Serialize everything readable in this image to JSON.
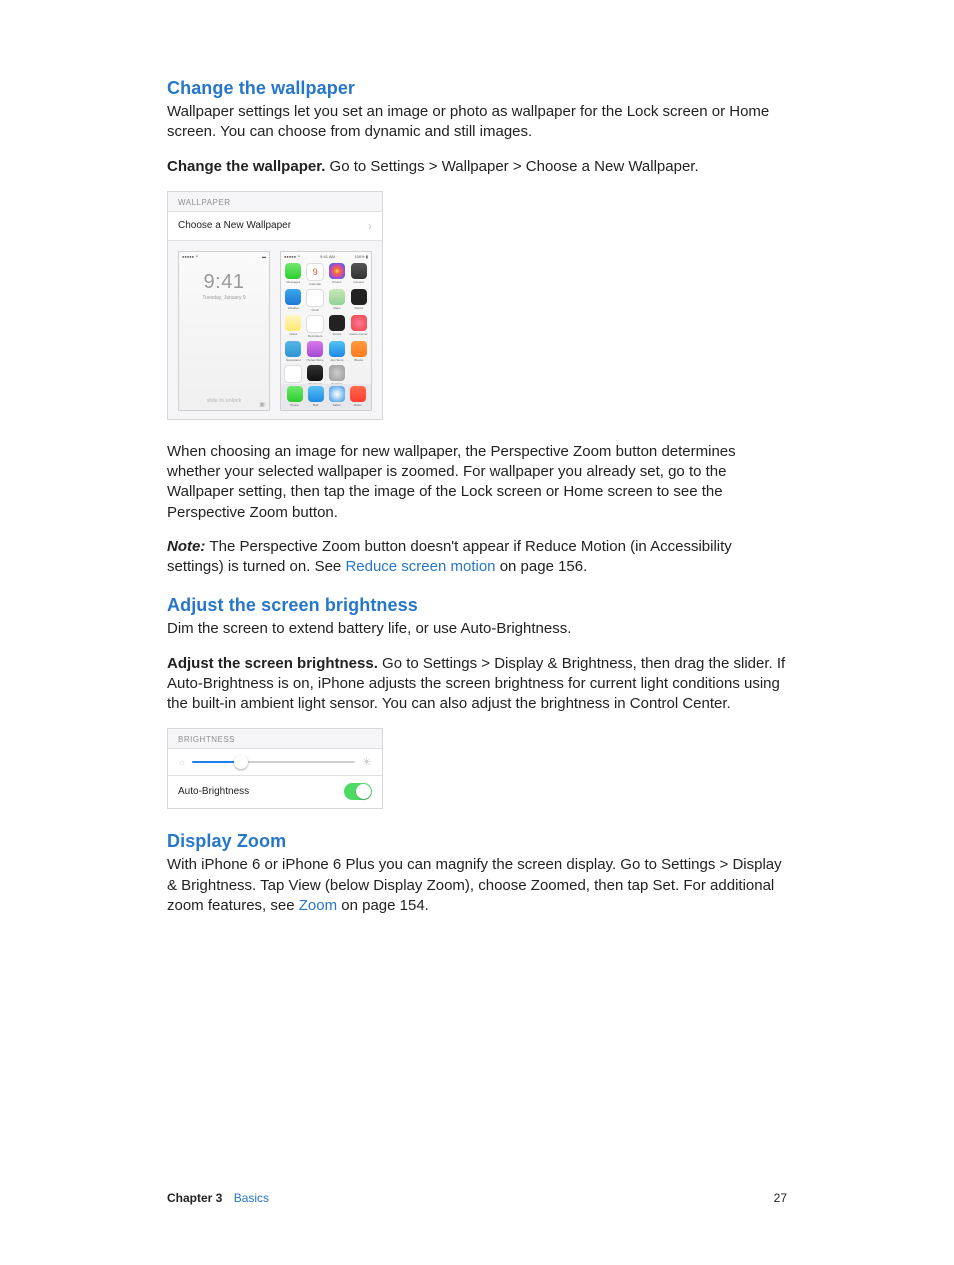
{
  "sections": {
    "wallpaper": {
      "heading": "Change the wallpaper",
      "p1": "Wallpaper settings let you set an image or photo as wallpaper for the Lock screen or Home screen. You can choose from dynamic and still images.",
      "p2_bold": "Change the wallpaper. ",
      "p2_rest": "Go to Settings > Wallpaper > Choose a New Wallpaper.",
      "p3": "When choosing an image for new wallpaper, the Perspective Zoom button determines whether your selected wallpaper is zoomed. For wallpaper you already set, go to the Wallpaper setting, then tap the image of the Lock screen or Home screen to see the Perspective Zoom button.",
      "note_label": "Note:  ",
      "note_a": "The Perspective Zoom button doesn't appear if Reduce Motion (in Accessibility settings) is turned on. See ",
      "note_link": "Reduce screen motion",
      "note_b": " on page 156."
    },
    "brightness": {
      "heading": "Adjust the screen brightness",
      "p1": "Dim the screen to extend battery life, or use Auto-Brightness.",
      "p2_bold": "Adjust the screen brightness. ",
      "p2_rest": "Go to Settings > Display & Brightness, then drag the slider. If Auto-Brightness is on, iPhone adjusts the screen brightness for current light conditions using the built-in ambient light sensor. You can also adjust the brightness in Control Center."
    },
    "zoom": {
      "heading": "Display Zoom",
      "p1_a": "With iPhone 6 or iPhone 6 Plus you can magnify the screen display. Go to Settings > Display & Brightness. Tap View (below Display Zoom), choose Zoomed, then tap Set. For additional zoom features, see ",
      "p1_link": "Zoom",
      "p1_b": " on page 154."
    }
  },
  "wallpaper_mock": {
    "header": "WALLPAPER",
    "row": "Choose a New Wallpaper",
    "lock": {
      "carrier": "●●●●● ⚬",
      "battery": "▬",
      "time": "9:41",
      "date": "Tuesday, January 9",
      "slide": "slide to unlock"
    },
    "home": {
      "carrier": "●●●●● ⚬",
      "time_top": "9:41 AM",
      "battery": "100% ▮",
      "apps": [
        {
          "label": "Messages",
          "color": "linear-gradient(#6fe96f,#2ecc2e)"
        },
        {
          "label": "Calendar",
          "color": "#fff",
          "text": "9",
          "textcolor": "#e53"
        },
        {
          "label": "Photos",
          "color": "radial-gradient(circle,#f7d54b,#ec6e3c,#d94aa0,#6a5ae2,#3cc2e8)"
        },
        {
          "label": "Camera",
          "color": "linear-gradient(#555,#333)"
        },
        {
          "label": "Weather",
          "color": "linear-gradient(#3aa7ea,#1e78d6)"
        },
        {
          "label": "Clock",
          "color": "#fff"
        },
        {
          "label": "Maps",
          "color": "linear-gradient(#c9e8b5,#8ed19a)"
        },
        {
          "label": "Videos",
          "color": "#222"
        },
        {
          "label": "Notes",
          "color": "linear-gradient(#fff8c0,#ffe770)"
        },
        {
          "label": "Reminders",
          "color": "#fff"
        },
        {
          "label": "Stocks",
          "color": "#222"
        },
        {
          "label": "Game Center",
          "color": "radial-gradient(circle,#f79,#e44)"
        },
        {
          "label": "Newsstand",
          "color": "linear-gradient(#58b7e8,#2e93d5)"
        },
        {
          "label": "iTunes Store",
          "color": "linear-gradient(#d977e8,#a24bd4)"
        },
        {
          "label": "App Store",
          "color": "linear-gradient(#55c1f2,#1e8ae6)"
        },
        {
          "label": "iBooks",
          "color": "linear-gradient(#ff9a3b,#ff7a1f)"
        },
        {
          "label": "Health",
          "color": "#fff"
        },
        {
          "label": "Passbook",
          "color": "linear-gradient(#333,#111)"
        },
        {
          "label": "Settings",
          "color": "radial-gradient(circle,#ccc,#9a9a9a)"
        }
      ],
      "dock": [
        {
          "label": "Phone",
          "color": "linear-gradient(#6fe96f,#2ecc2e)"
        },
        {
          "label": "Mail",
          "color": "linear-gradient(#55c1f2,#1e8ae6)"
        },
        {
          "label": "Safari",
          "color": "radial-gradient(circle,#fff,#2e93e8)"
        },
        {
          "label": "Music",
          "color": "linear-gradient(#ff6a4d,#ff3b30)"
        }
      ]
    }
  },
  "brightness_mock": {
    "header": "BRIGHTNESS",
    "row": "Auto-Brightness",
    "on": true
  },
  "footer": {
    "chapter": "Chapter  3",
    "label": "Basics",
    "page": "27"
  }
}
